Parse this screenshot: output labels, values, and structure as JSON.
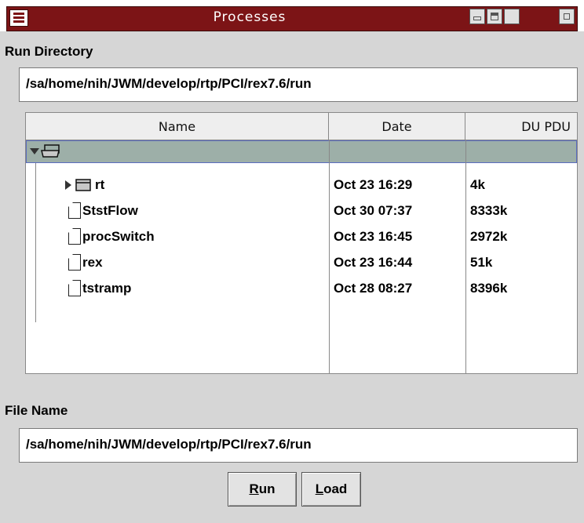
{
  "window": {
    "title": "Processes"
  },
  "run_directory": {
    "label": "Run Directory",
    "value": "/sa/home/nih/JWM/develop/rtp/PCI/rex7.6/run"
  },
  "file_list": {
    "columns": {
      "name": "Name",
      "date": "Date",
      "size": "DU PDU"
    },
    "rows": [
      {
        "name": "rt",
        "date": "Oct 23 16:29",
        "size": "4k",
        "type": "folder"
      },
      {
        "name": "StstFlow",
        "date": "Oct 30 07:37",
        "size": "8333k",
        "type": "file"
      },
      {
        "name": "procSwitch",
        "date": "Oct 23 16:45",
        "size": "2972k",
        "type": "file"
      },
      {
        "name": "rex",
        "date": "Oct 23 16:44",
        "size": "51k",
        "type": "file"
      },
      {
        "name": "tstramp",
        "date": "Oct 28 08:27",
        "size": "8396k",
        "type": "file"
      }
    ]
  },
  "file_name": {
    "label": "File Name",
    "value": "/sa/home/nih/JWM/develop/rtp/PCI/rex7.6/run"
  },
  "buttons": {
    "run": {
      "mnemonic": "R",
      "rest": "un"
    },
    "load": {
      "mnemonic": "L",
      "rest": "oad"
    }
  },
  "colors": {
    "titlebar": "#7c1416",
    "selection": "#9dafa8",
    "panel": "#d6d6d6"
  },
  "icons": [
    "window-menu-icon",
    "iconify-icon",
    "shade-icon",
    "maximize-icon",
    "close-icon",
    "folder-open-icon",
    "folder-icon",
    "file-icon"
  ]
}
